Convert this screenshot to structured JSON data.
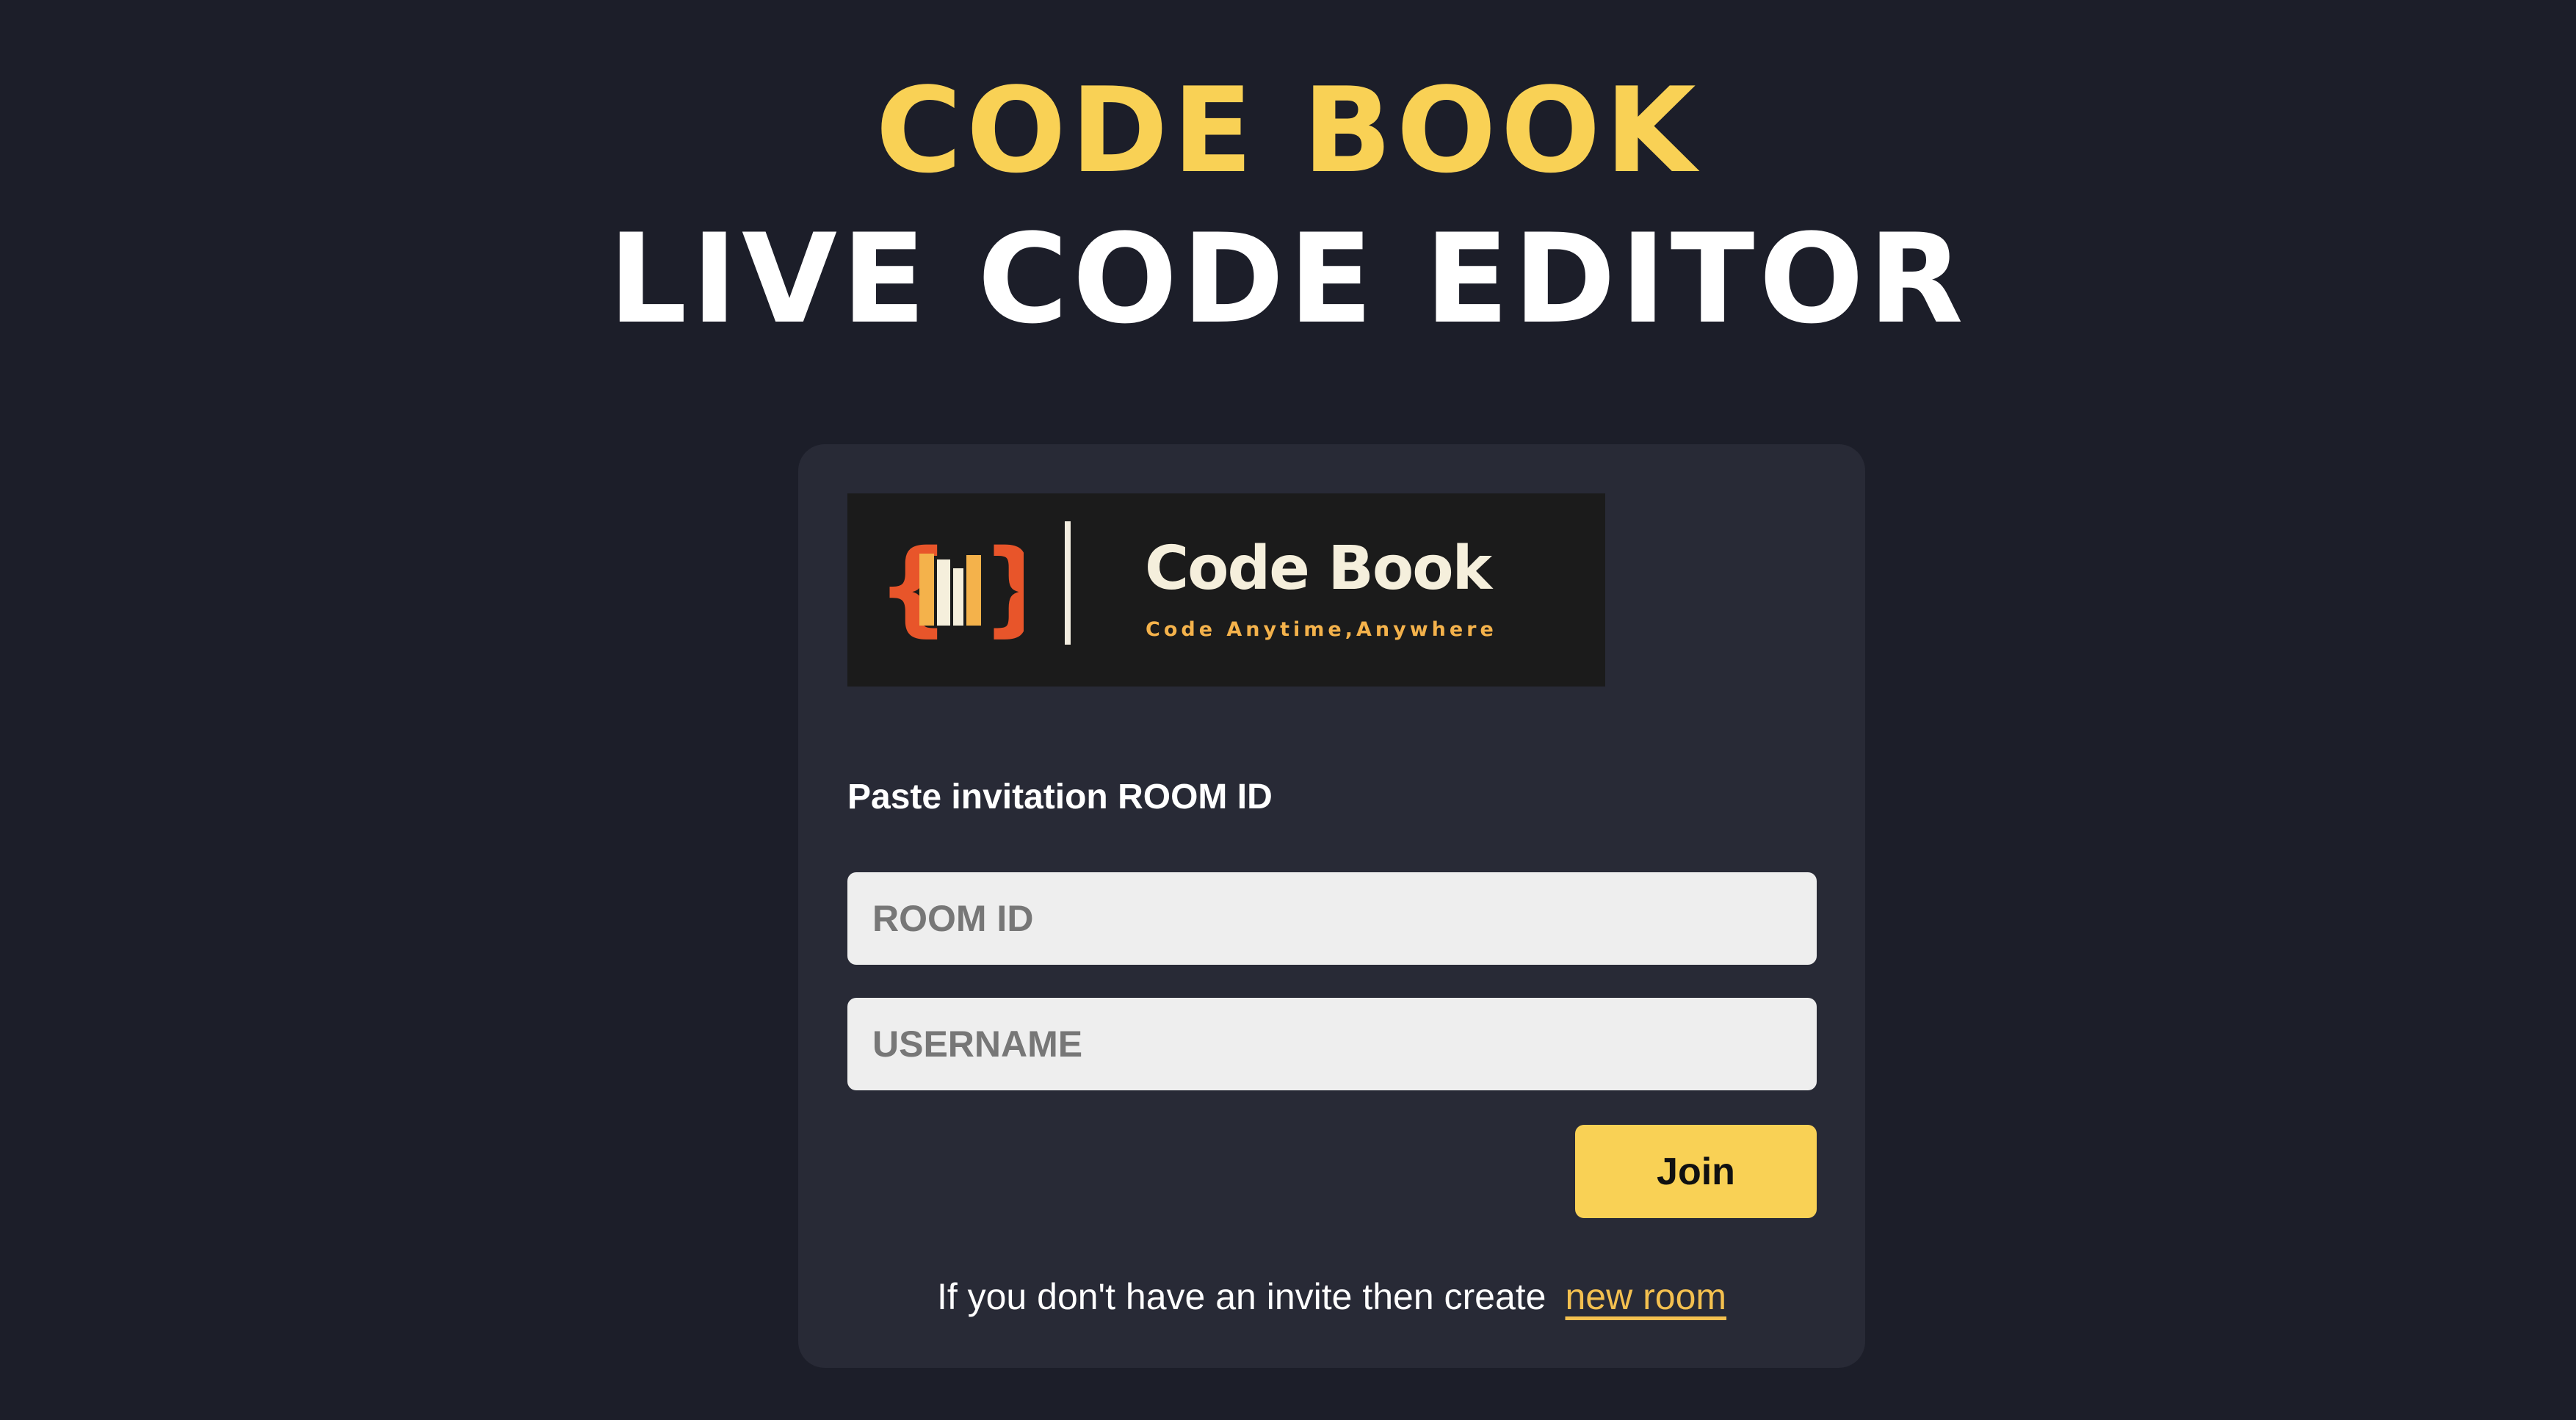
{
  "hero": {
    "title": "CODE BOOK",
    "subtitle": "LIVE CODE EDITOR"
  },
  "logo": {
    "name": "Code Book",
    "tagline": "Code Anytime,Anywhere",
    "icon": "book-braces-icon"
  },
  "form": {
    "label": "Paste invitation ROOM ID",
    "room_id": {
      "value": "",
      "placeholder": "ROOM ID"
    },
    "username": {
      "value": "",
      "placeholder": "USERNAME"
    },
    "join_label": "Join"
  },
  "footer": {
    "text": "If you don't have an invite then create",
    "link_label": "new room"
  },
  "colors": {
    "background": "#1c1e29",
    "card": "#282a36",
    "accent": "#f9d155",
    "logo_background": "#1b1b1b",
    "logo_brace": "#e8552a",
    "input_background": "#eeeeee"
  }
}
